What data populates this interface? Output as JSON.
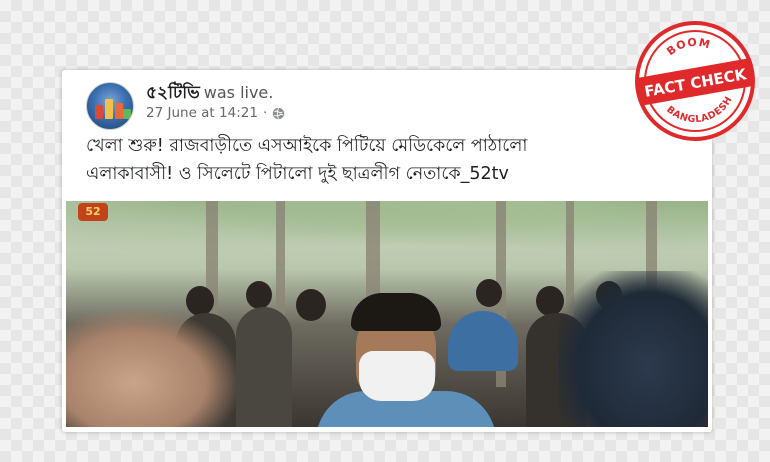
{
  "post": {
    "page_name": "৫২টিভি",
    "status": "was live.",
    "date": "27 June at 14:21",
    "separator": "·",
    "privacy_icon": "globe-icon",
    "text_line1": "খেলা শুরু! রাজবাড়ীতে এসআইকে পিটিয়ে মেডিকেলে পাঠালো",
    "text_line2": "এলাকাবাসী! ও সিলেটে পিটালো দুই ছাত্রলীগ নেতাকে_52tv",
    "video_logo": "52"
  },
  "stamp": {
    "top": "BOOM",
    "center": "FACT CHECK",
    "bottom": "BANGLADESH",
    "color": "#e0292b"
  },
  "colors": {
    "card_bg": "#ffffff",
    "text": "#1c1e21",
    "meta": "#65676b"
  }
}
